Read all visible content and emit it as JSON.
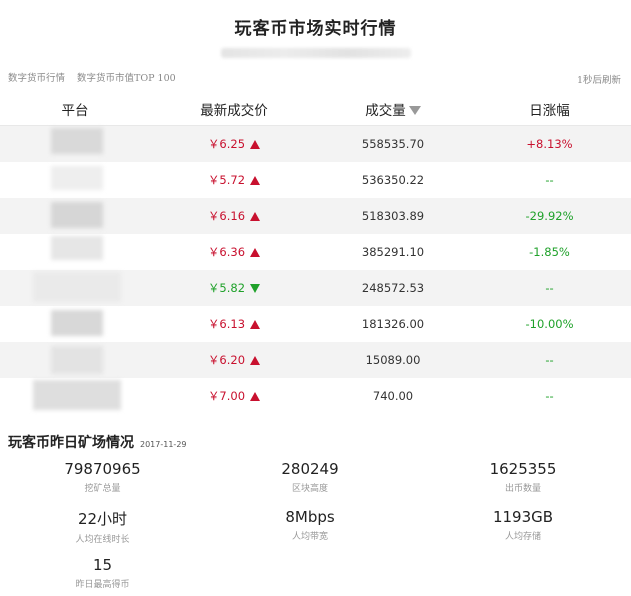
{
  "header": {
    "title": "玩客币市场实时行情"
  },
  "tabs": [
    {
      "label": "数字货币行情"
    },
    {
      "label": "数字货币市值TOP 100"
    }
  ],
  "refresh_label": "1秒后刷新",
  "table": {
    "columns": [
      "平台",
      "最新成交价",
      "成交量",
      "日涨幅"
    ],
    "rows": [
      {
        "price": "￥6.25",
        "dir": "up",
        "volume": "558535.70",
        "change": "+8.13%",
        "change_dir": "up"
      },
      {
        "price": "￥5.72",
        "dir": "up",
        "volume": "536350.22",
        "change": "--",
        "change_dir": "flat"
      },
      {
        "price": "￥6.16",
        "dir": "up",
        "volume": "518303.89",
        "change": "-29.92%",
        "change_dir": "down"
      },
      {
        "price": "￥6.36",
        "dir": "up",
        "volume": "385291.10",
        "change": "-1.85%",
        "change_dir": "down"
      },
      {
        "price": "￥5.82",
        "dir": "down",
        "volume": "248572.53",
        "change": "--",
        "change_dir": "flat"
      },
      {
        "price": "￥6.13",
        "dir": "up",
        "volume": "181326.00",
        "change": "-10.00%",
        "change_dir": "down"
      },
      {
        "price": "￥6.20",
        "dir": "up",
        "volume": "15089.00",
        "change": "--",
        "change_dir": "flat"
      },
      {
        "price": "￥7.00",
        "dir": "up",
        "volume": "740.00",
        "change": "--",
        "change_dir": "flat"
      }
    ]
  },
  "mining": {
    "title": "玩客币昨日矿场情况",
    "date": "2017-11-29",
    "stats": [
      {
        "value": "79870965",
        "label": "挖矿总量"
      },
      {
        "value": "280249",
        "label": "区块高度"
      },
      {
        "value": "1625355",
        "label": "出币数量"
      },
      {
        "value": "22小时",
        "label": "人均在线时长"
      },
      {
        "value": "8Mbps",
        "label": "人均带宽"
      },
      {
        "value": "1193GB",
        "label": "人均存储"
      },
      {
        "value": "15",
        "label": "昨日最高得币"
      }
    ]
  },
  "colors": {
    "up": "#c8102e",
    "down": "#1fa12a",
    "row_alt": "#f3f3f3"
  }
}
